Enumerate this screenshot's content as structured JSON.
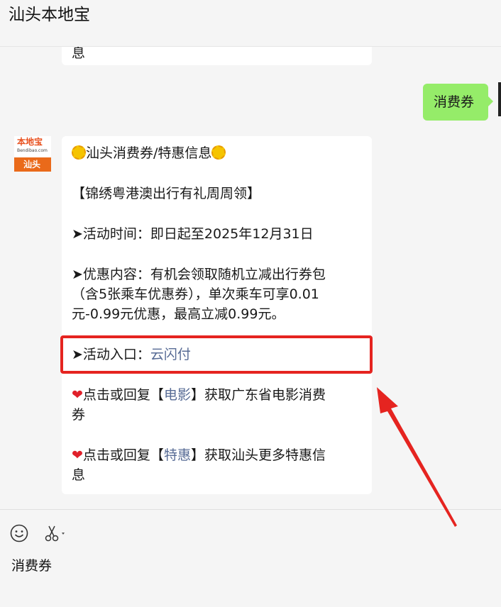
{
  "window": {
    "title": "汕头本地宝"
  },
  "messages": {
    "previous_tail": "息",
    "sent": "消费券",
    "avatar": {
      "brand": "本地宝",
      "domain": "Bendibao.com",
      "city": "汕头"
    },
    "reply": {
      "title": "汕头消费券/特惠信息",
      "subtitle": "【锦绣粤港澳出行有礼周周领】",
      "time_line": "➤活动时间：即日起至2025年12月31日",
      "content_line1": "➤优惠内容：有机会领取随机立减出行券包",
      "content_line2": "（含5张乘车优惠券），单次乘车可享0.01",
      "content_line3": "元-0.99元优惠，最高立减0.99元。",
      "entry_prefix": "➤活动入口：",
      "entry_link": "云闪付",
      "movie_prefix": "点击或回复【",
      "movie_link": "电影",
      "movie_suffix": "】获取广东省电影消费",
      "movie_line2": "券",
      "deal_prefix": "点击或回复【",
      "deal_link": "特惠",
      "deal_suffix": "】获取汕头更多特惠信",
      "deal_line2": "息"
    }
  },
  "input": {
    "value": "消费券"
  },
  "colors": {
    "sent_bubble": "#95ec69",
    "link": "#576b95",
    "highlight": "#e52420",
    "background": "#f5f5f5"
  },
  "icons": [
    "sun-icon",
    "heart-icon",
    "emoji-icon",
    "scissors-icon",
    "arrow-annotation"
  ]
}
